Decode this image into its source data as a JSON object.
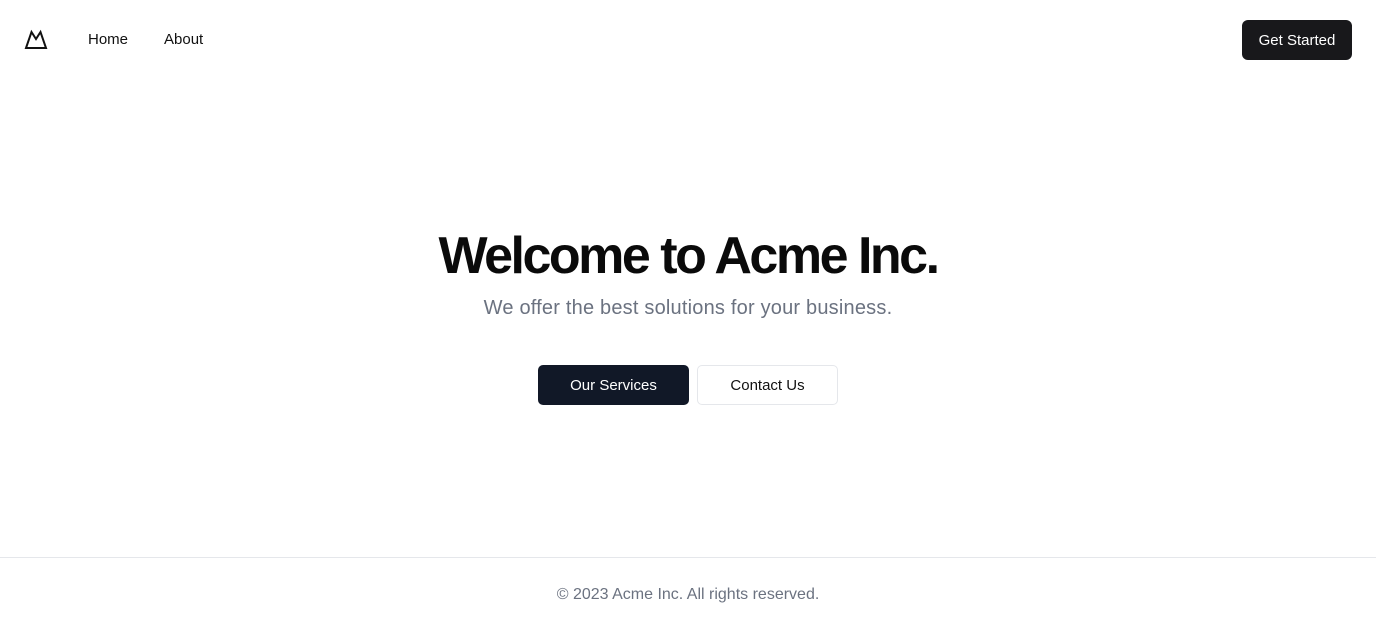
{
  "header": {
    "logo_icon": "mountain-icon",
    "nav": [
      {
        "label": "Home"
      },
      {
        "label": "About"
      }
    ],
    "cta_label": "Get Started"
  },
  "hero": {
    "title": "Welcome to Acme Inc.",
    "subtitle": "We offer the best solutions for your business.",
    "primary_label": "Our Services",
    "secondary_label": "Contact Us"
  },
  "footer": {
    "text": "© 2023 Acme Inc. All rights reserved."
  },
  "colors": {
    "background": "#ffffff",
    "primary_button": "#111827",
    "header_button": "#18181b",
    "muted_text": "#6b7280",
    "border": "#e5e7eb"
  }
}
